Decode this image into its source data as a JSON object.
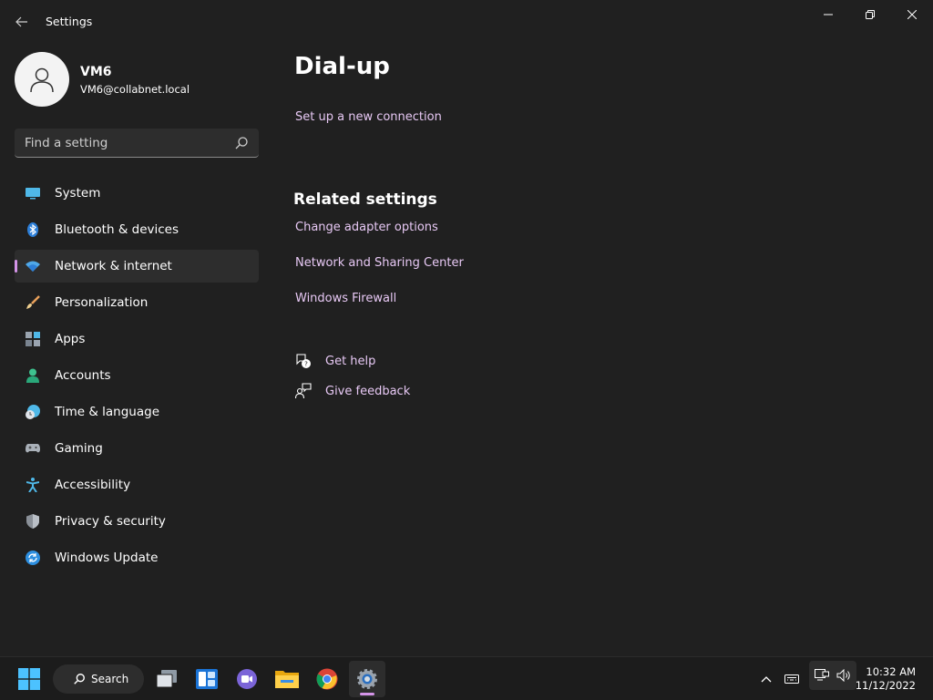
{
  "window": {
    "title": "Settings",
    "back_icon": "back-arrow-icon",
    "controls": [
      "minimize-icon",
      "restore-icon",
      "close-icon"
    ]
  },
  "profile": {
    "name": "VM6",
    "email": "VM6@collabnet.local"
  },
  "search": {
    "placeholder": "Find a setting",
    "value": ""
  },
  "sidebar": {
    "items": [
      {
        "label": "System",
        "icon": "system-icon",
        "active": false
      },
      {
        "label": "Bluetooth & devices",
        "icon": "bluetooth-icon",
        "active": false
      },
      {
        "label": "Network & internet",
        "icon": "wifi-icon",
        "active": true
      },
      {
        "label": "Personalization",
        "icon": "brush-icon",
        "active": false
      },
      {
        "label": "Apps",
        "icon": "apps-icon",
        "active": false
      },
      {
        "label": "Accounts",
        "icon": "person-icon",
        "active": false
      },
      {
        "label": "Time & language",
        "icon": "clock-globe-icon",
        "active": false
      },
      {
        "label": "Gaming",
        "icon": "gamepad-icon",
        "active": false
      },
      {
        "label": "Accessibility",
        "icon": "accessibility-icon",
        "active": false
      },
      {
        "label": "Privacy & security",
        "icon": "shield-icon",
        "active": false
      },
      {
        "label": "Windows Update",
        "icon": "update-icon",
        "active": false
      }
    ]
  },
  "main": {
    "title": "Dial-up",
    "setup_link": "Set up a new connection",
    "related_title": "Related settings",
    "related_links": [
      "Change adapter options",
      "Network and Sharing Center",
      "Windows Firewall"
    ],
    "help": [
      {
        "label": "Get help",
        "icon": "help-chat-icon"
      },
      {
        "label": "Give feedback",
        "icon": "feedback-icon"
      }
    ]
  },
  "taskbar": {
    "search_label": "Search",
    "time": "10:32 AM",
    "date": "11/12/2022"
  },
  "colors": {
    "background": "#202020",
    "accent": "#d494e8",
    "link": "#e7c8f4",
    "taskbar": "#1c1c1c"
  }
}
